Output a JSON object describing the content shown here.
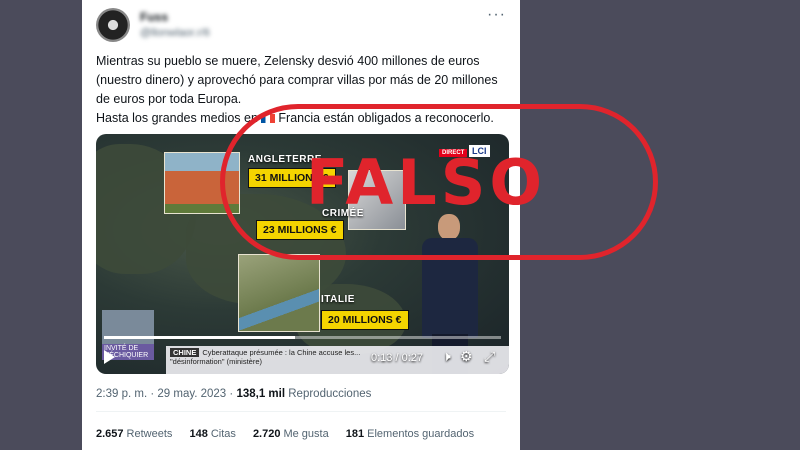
{
  "tweet": {
    "author_name": "Fuss",
    "author_handle": "@llonwlaor.r/6",
    "more_icon": "more-horizontal-icon",
    "text_lines": [
      "Mientras su pueblo se muere, Zelensky desvió 400 millones de euros",
      "(nuestro dinero) y aprovechó para comprar villas por más de 20 millones",
      "de euros por toda Europa.",
      "Hasta los grandes medios en",
      "Francia están obligados a reconocerlo."
    ]
  },
  "video": {
    "channel_direct": "DIRECT",
    "channel_name": "LCI",
    "places": [
      "ANGLETERRE",
      "CRIMÉE",
      "ITALIE"
    ],
    "prices": [
      "31 MILLIONS €",
      "23 MILLIONS €",
      "20 MILLIONS €"
    ],
    "guest_label": "INVITÉ DE L'ÉCHIQUIER",
    "ticker_tag": "CHINE",
    "ticker_text": "Cyberattaque présumée : la Chine accuse les...",
    "ticker_text2": "\"désinformation\" (ministère)",
    "time_display": "0:13 / 0:27",
    "progress": 0.48,
    "play_icon": "play-icon",
    "volume_icon": "volume-icon",
    "settings_icon": "gear-icon",
    "fullscreen_icon": "fullscreen-icon"
  },
  "stamp": {
    "text": "FALSO",
    "color": "#e0242c"
  },
  "meta": {
    "time": "2:39 p. m.",
    "date": "29 may. 2023",
    "views": "138,1 mil",
    "views_label": "Reproducciones"
  },
  "stats": [
    {
      "count": "2.657",
      "label": "Retweets"
    },
    {
      "count": "148",
      "label": "Citas"
    },
    {
      "count": "2.720",
      "label": "Me gusta"
    },
    {
      "count": "181",
      "label": "Elementos guardados"
    }
  ]
}
